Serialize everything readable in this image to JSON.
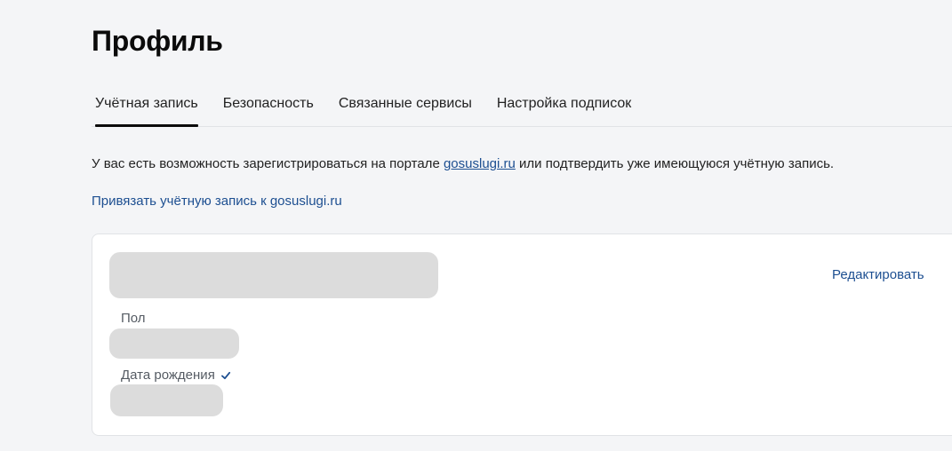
{
  "page": {
    "title": "Профиль"
  },
  "tabs": [
    {
      "label": "Учётная запись",
      "active": true
    },
    {
      "label": "Безопасность",
      "active": false
    },
    {
      "label": "Связанные сервисы",
      "active": false
    },
    {
      "label": "Настройка подписок",
      "active": false
    }
  ],
  "info": {
    "text_before": "У вас есть возможность зарегистрироваться на портале ",
    "link_text": "gosuslugi.ru",
    "text_after": " или подтвердить уже имеющуюся учётную запись."
  },
  "bind_link": {
    "label": "Привязать учётную запись к gosuslugi.ru"
  },
  "card": {
    "edit_label": "Редактировать",
    "fields": {
      "gender_label": "Пол",
      "birth_label": "Дата рождения"
    },
    "check_icon": "check-icon"
  },
  "colors": {
    "accent_link": "#1d4f91",
    "skeleton": "#dcdcdc",
    "background": "#f4f5f7"
  }
}
